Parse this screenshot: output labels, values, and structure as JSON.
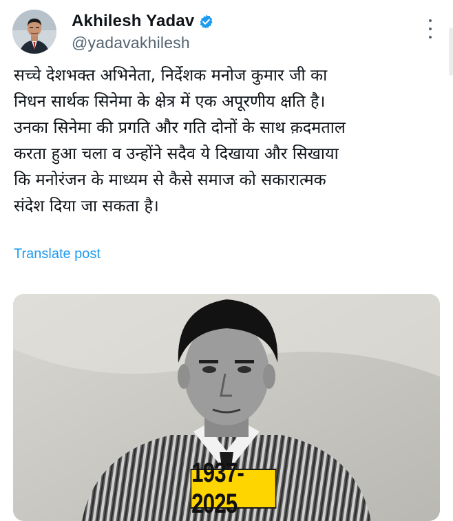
{
  "post": {
    "author": {
      "display_name": "Akhilesh Yadav",
      "handle": "@yadavakhilesh",
      "verified": true,
      "avatar_icon": "profile-avatar"
    },
    "more_icon": "more-vertical-icon",
    "text_lines": [
      "सच्चे देशभक्त अभिनेता, निर्देशक मनोज कुमार जी का",
      "निधन सार्थक सिनेमा के क्षेत्र में एक अपूरणीय क्षति है।",
      "उनका सिनेमा की प्रगति और गति दोनों के साथ क़दमताल",
      "करता हुआ चला व उन्होंने सदैव ये दिखाया और सिखाया",
      "कि मनोरंजन के माध्यम से कैसे समाज को सकारात्मक",
      "संदेश दिया जा सकता है।"
    ],
    "translate_label": "Translate post",
    "media": {
      "year_badge": "1937-2025",
      "badge_color": "#ffd500"
    }
  },
  "colors": {
    "text_primary": "#0f1419",
    "text_secondary": "#536471",
    "link_blue": "#1d9bf0",
    "verified_blue": "#1d9bf0"
  }
}
